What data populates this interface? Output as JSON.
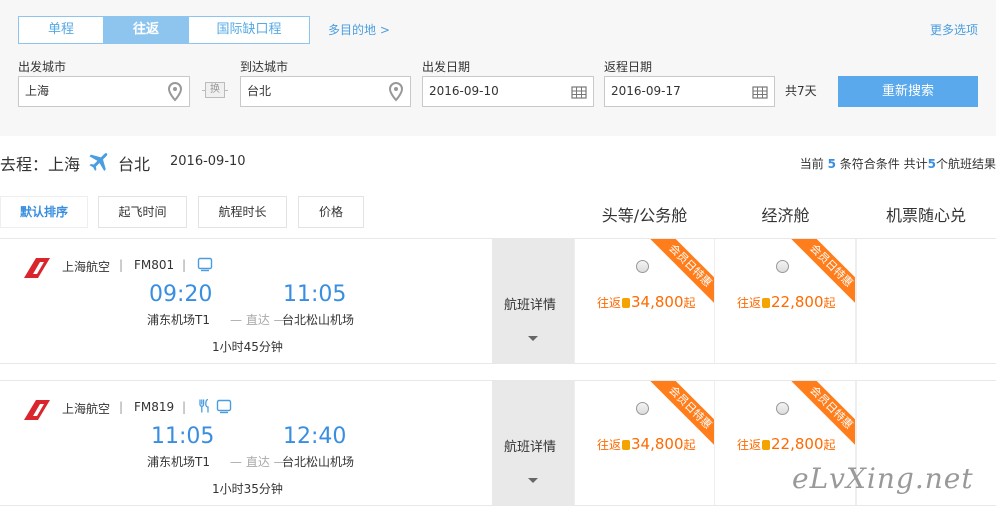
{
  "trip_tabs": [
    "单程",
    "往返",
    "国际缺口程"
  ],
  "multi_dest": "多目的地 >",
  "more_options": "更多选项",
  "fields": {
    "from": {
      "label": "出发城市",
      "value": "上海"
    },
    "to": {
      "label": "到达城市",
      "value": "台北"
    },
    "depart": {
      "label": "出发日期",
      "value": "2016-09-10"
    },
    "return": {
      "label": "返程日期",
      "value": "2016-09-17"
    }
  },
  "swap_label": "换",
  "total_days": "共7天",
  "search_button": "重新搜索",
  "route": {
    "from": "去程：上海",
    "to": "台北",
    "date": "2016-09-10",
    "result_prefix": "当前",
    "result_count": "5",
    "result_mid": "条符合条件 共计",
    "total_count": "5",
    "result_suffix": "个航班结果"
  },
  "sort": [
    "默认排序",
    "起飞时间",
    "航程时长",
    "价格"
  ],
  "columns": [
    "头等/公务舱",
    "经济舱",
    "机票随心兑"
  ],
  "flights": [
    {
      "airline": "上海航空",
      "flight_no": "FM801",
      "dep_time": "09:20",
      "arr_time": "11:05",
      "dep_airport": "浦东机场T1",
      "arr_airport": "台北松山机场",
      "direct": "— 直达 —",
      "duration": "1小时45分钟",
      "detail": "航班详情",
      "fares": [
        {
          "roundtrip": "往返",
          "price": "34,800",
          "suffix": "起",
          "badge": "会员日特惠"
        },
        {
          "roundtrip": "往返",
          "price": "22,800",
          "suffix": "起",
          "badge": "会员日特惠"
        }
      ]
    },
    {
      "airline": "上海航空",
      "flight_no": "FM819",
      "dep_time": "11:05",
      "arr_time": "12:40",
      "dep_airport": "浦东机场T1",
      "arr_airport": "台北松山机场",
      "direct": "— 直达 —",
      "duration": "1小时35分钟",
      "detail": "航班详情",
      "fares": [
        {
          "roundtrip": "往返",
          "price": "34,800",
          "suffix": "起",
          "badge": "会员日特惠"
        },
        {
          "roundtrip": "往返",
          "price": "22,800",
          "suffix": "起",
          "badge": "会员日特惠"
        }
      ]
    }
  ],
  "watermark": "eLvXing.net"
}
